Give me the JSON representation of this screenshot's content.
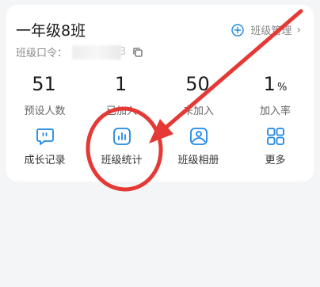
{
  "class_card": {
    "title": "一年级8班",
    "manage_label": "班级管理",
    "chevron": "›",
    "code_label": "班级口令：",
    "code_tail": "3",
    "icons": {
      "add": "plus-circle-icon",
      "copy": "copy-icon"
    }
  },
  "stats": [
    {
      "value": "51",
      "unit": "",
      "label": "预设人数"
    },
    {
      "value": "1",
      "unit": "",
      "label": "已加入"
    },
    {
      "value": "50",
      "unit": "",
      "label": "未加入"
    },
    {
      "value": "1",
      "unit": "%",
      "label": "加入率"
    }
  ],
  "tools": [
    {
      "label": "成长记录",
      "icon": "chat-bubble-icon"
    },
    {
      "label": "班级统计",
      "icon": "bar-chart-icon"
    },
    {
      "label": "班级相册",
      "icon": "photo-album-icon"
    },
    {
      "label": "更多",
      "icon": "grid-icon"
    }
  ],
  "colors": {
    "accent": "#1e88e5",
    "annotation": "#e53935",
    "background": "#f4f5f7"
  }
}
